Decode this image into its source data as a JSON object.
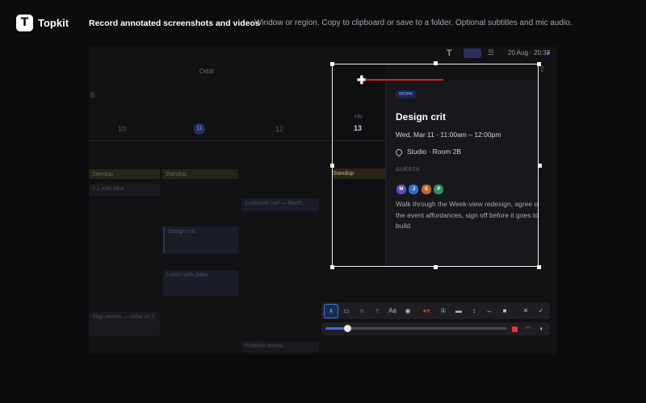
{
  "header": {
    "brand": "Topkit",
    "logo_glyph": "T",
    "headline": "Record annotated screenshots and videos",
    "tagline": "Window or region. Copy to clipboard or save to a folder. Optional subtitles and mic audio."
  },
  "background_app": {
    "title": "Orbit",
    "partial_letter": "B",
    "days": [
      "10",
      "11",
      "12"
    ],
    "today": "11",
    "events": [
      {
        "label": "Standup",
        "kind": "standup"
      },
      {
        "label": "Standup",
        "kind": "standup"
      },
      {
        "label": "1:1 with Mira",
        "kind": "gray"
      },
      {
        "label": "Customer call — North...",
        "kind": "blue"
      },
      {
        "label": "Design crit",
        "kind": "blue"
      },
      {
        "label": "Lunch with Jules",
        "kind": "blue"
      },
      {
        "label": "Ship review — Orbit v2.2",
        "kind": "gray"
      },
      {
        "label": "Portfolio review",
        "kind": "gray"
      }
    ],
    "menubar": {
      "t_icon": "T",
      "date": "20 Aug · 20:37",
      "share_icon": "share-icon"
    }
  },
  "selection": {
    "day_name": "FRI",
    "day_number": "13",
    "standup": "Standup",
    "event": {
      "tag": "WORK",
      "title": "Design crit",
      "time": "Wed, Mar 11 · 11:00am – 12:00pm",
      "location": "Studio · Room 2B",
      "guests_label": "GUESTS",
      "guests": [
        {
          "initial": "M",
          "color": "#5b4cc9"
        },
        {
          "initial": "J",
          "color": "#2e6fd1"
        },
        {
          "initial": "S",
          "color": "#c06a25"
        },
        {
          "initial": "P",
          "color": "#2f8f5f"
        }
      ],
      "description": "Walk through the Week-view redesign, agree on the event affordances, sign off before it goes to build."
    }
  },
  "annotation": {
    "color": "#e02020"
  },
  "toolbar": {
    "tools": [
      {
        "name": "pen-tool",
        "glyph": "∧",
        "active": true
      },
      {
        "name": "rectangle-tool",
        "glyph": "▭"
      },
      {
        "name": "ellipse-tool",
        "glyph": "○"
      },
      {
        "name": "arrow-tool",
        "glyph": "↑"
      },
      {
        "name": "text-tool",
        "glyph": "Aa"
      },
      {
        "name": "blur-tool",
        "glyph": "◉"
      },
      {
        "name": "color-picker",
        "glyph": "●▾"
      },
      {
        "name": "step-tool",
        "glyph": "①"
      },
      {
        "name": "line-weight-tool",
        "glyph": "▬"
      },
      {
        "name": "resize-vertical-tool",
        "glyph": "↕"
      },
      {
        "name": "resize-horizontal-tool",
        "glyph": "↔"
      },
      {
        "name": "fill-tool",
        "glyph": "■"
      },
      {
        "name": "cancel-button",
        "glyph": "✕"
      },
      {
        "name": "confirm-button",
        "glyph": "✓"
      }
    ],
    "accent": "#2f6fff",
    "progress": 0.12
  }
}
